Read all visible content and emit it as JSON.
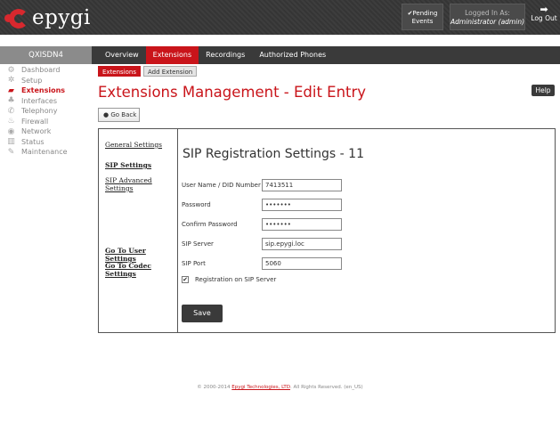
{
  "header": {
    "logo_text": "epygi",
    "pending_line1": "✔Pending",
    "pending_line2": "Events",
    "logged_line1": "Logged In As:",
    "logged_line2": "Administrator (admin)",
    "logout_label": "Log Out"
  },
  "device_name": "QXISDN4",
  "top_tabs": [
    "Overview",
    "Extensions",
    "Recordings",
    "Authorized Phones"
  ],
  "sidebar": {
    "items": [
      {
        "label": "Dashboard",
        "icon": "dashboard-icon"
      },
      {
        "label": "Setup",
        "icon": "gear-icon"
      },
      {
        "label": "Extensions",
        "icon": "book-icon"
      },
      {
        "label": "Interfaces",
        "icon": "interfaces-icon"
      },
      {
        "label": "Telephony",
        "icon": "phone-icon"
      },
      {
        "label": "Firewall",
        "icon": "fire-icon"
      },
      {
        "label": "Network",
        "icon": "globe-icon"
      },
      {
        "label": "Status",
        "icon": "status-icon"
      },
      {
        "label": "Maintenance",
        "icon": "wrench-icon"
      }
    ]
  },
  "sub_tabs": [
    "Extensions",
    "Add Extension"
  ],
  "page_title": "Extensions Management - Edit Entry",
  "help_label": "Help",
  "go_back_label": "Go Back",
  "panel_links": {
    "general": "General Settings",
    "sip": "SIP Settings",
    "sip_adv": "SIP Advanced Settings",
    "user": "Go To User Settings",
    "codec": "Go To Codec Settings"
  },
  "form": {
    "title": "SIP Registration Settings - 11",
    "username_label": "User Name / DID Number",
    "username_value": "7413511",
    "password_label": "Password",
    "password_value": "•••••••",
    "confirm_label": "Confirm Password",
    "confirm_value": "•••••••",
    "server_label": "SIP Server",
    "server_value": "sip.epygi.loc",
    "port_label": "SIP Port",
    "port_value": "5060",
    "registration_label": "Registration on SIP Server",
    "registration_checked": true,
    "save_label": "Save"
  },
  "footer": {
    "prefix": "© 2000-2014",
    "company": "Epygi Technologies, LTD",
    "suffix": ". All Rights Reserved. (en_US)"
  },
  "colors": {
    "accent": "#c9141a",
    "dark": "#3a3a3a"
  }
}
